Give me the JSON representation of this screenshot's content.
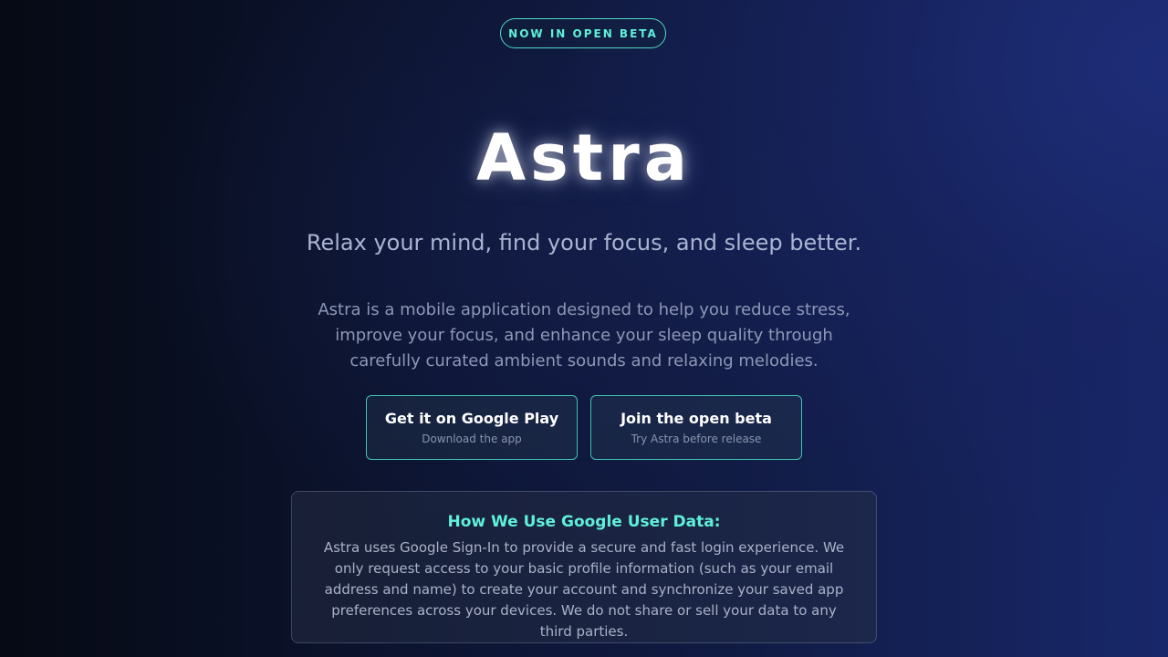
{
  "badge": {
    "label": "NOW IN OPEN BETA"
  },
  "hero": {
    "title": "Astra",
    "tagline": "Relax your mind, find your focus, and sleep better.",
    "description": "Astra is a mobile application designed to help you reduce stress, improve your focus, and enhance your sleep quality through carefully curated ambient sounds and relaxing melodies."
  },
  "cta": {
    "google_play": {
      "label": "Get it on Google Play",
      "sublabel": "Download the app"
    },
    "beta": {
      "label": "Join the open beta",
      "sublabel": "Try Astra before release"
    }
  },
  "google_data": {
    "heading": "How We Use Google User Data:",
    "body": "Astra uses Google Sign-In to provide a secure and fast login experience. We only request access to your basic profile information (such as your email address and name) to create your account and synchronize your saved app preferences across your devices. We do not share or sell your data to any third parties."
  },
  "colors": {
    "accent": "#5ef0d8",
    "button_border": "#3fc2b0",
    "background_dark": "#060a14",
    "background_blue": "#18276a"
  }
}
